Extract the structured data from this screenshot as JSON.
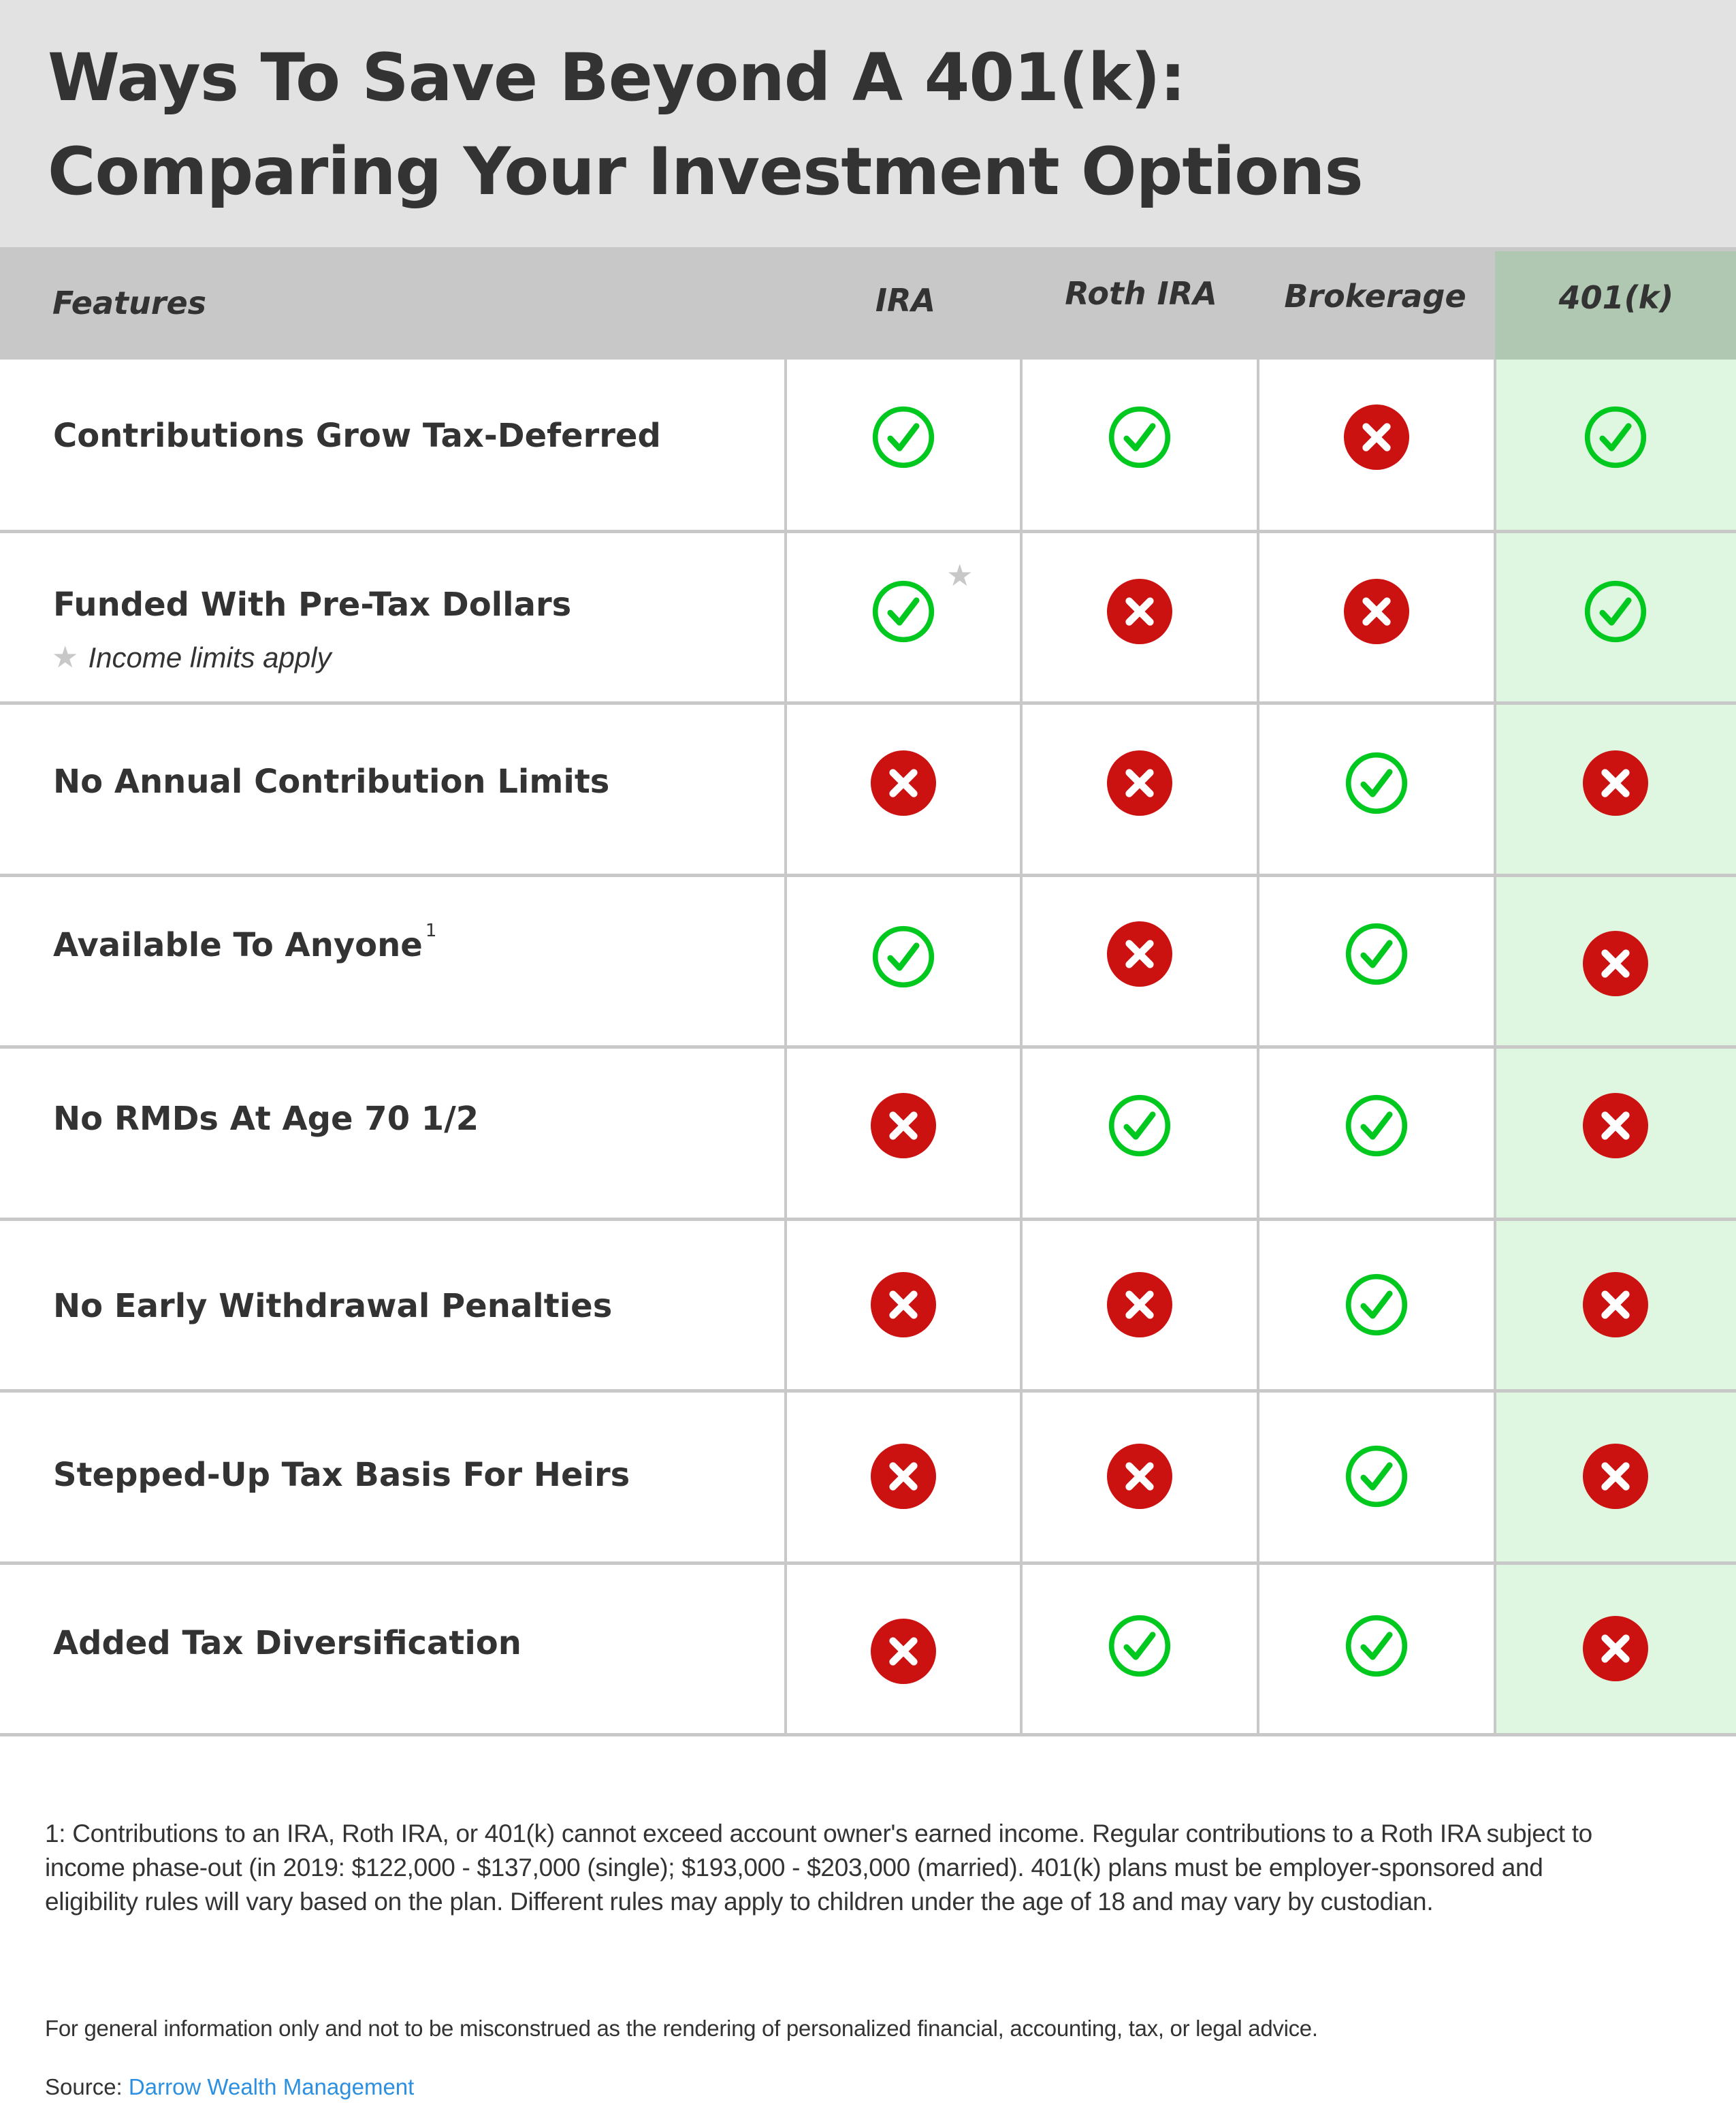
{
  "title": {
    "line1": "Ways To Save Beyond A 401(k):",
    "line2": "Comparing Your Investment Options"
  },
  "columns": {
    "features": "Features",
    "ira": "IRA",
    "roth_ira": "Roth IRA",
    "brokerage": "Brokerage",
    "k401": "401(k)"
  },
  "rows": [
    {
      "feature": "Contributions Grow Tax-Deferred",
      "ira": "check",
      "roth_ira": "check",
      "brokerage": "x",
      "k401": "check"
    },
    {
      "feature": "Funded With Pre-Tax Dollars",
      "note": "Income limits apply",
      "ira": "check",
      "ira_starred": true,
      "roth_ira": "x",
      "brokerage": "x",
      "k401": "check"
    },
    {
      "feature": "No Annual Contribution Limits",
      "ira": "x",
      "roth_ira": "x",
      "brokerage": "check",
      "k401": "x"
    },
    {
      "feature": "Available To Anyone",
      "footnote_ref": "1",
      "ira": "check",
      "roth_ira": "x",
      "brokerage": "check",
      "k401": "x"
    },
    {
      "feature": "No RMDs At Age 70 1/2",
      "ira": "x",
      "roth_ira": "check",
      "brokerage": "check",
      "k401": "x"
    },
    {
      "feature": "No Early Withdrawal Penalties",
      "ira": "x",
      "roth_ira": "x",
      "brokerage": "check",
      "k401": "x"
    },
    {
      "feature": "Stepped-Up Tax Basis For Heirs",
      "ira": "x",
      "roth_ira": "x",
      "brokerage": "check",
      "k401": "x"
    },
    {
      "feature": "Added Tax Diversification",
      "ira": "x",
      "roth_ira": "check",
      "brokerage": "check",
      "k401": "x"
    }
  ],
  "icons": {
    "check": "check-circle-icon",
    "x": "x-circle-icon",
    "star": "star-icon"
  },
  "colors": {
    "check": "#00C81E",
    "x": "#CC1111",
    "highlight_column": "#DFF7E0",
    "highlight_header": "#B0C8B2",
    "link": "#2D8FE0"
  },
  "star_glyph": "★",
  "footnote": "1: Contributions to an IRA, Roth IRA, or 401(k) cannot exceed account owner's earned income. Regular contributions to a Roth IRA subject to income phase-out (in 2019: $122,000 - $137,000 (single); $193,000 - $203,000 (married). 401(k) plans must be employer-sponsored and eligibility rules will vary based on the plan. Different rules may apply to children under the age of 18 and may vary by custodian.",
  "disclaimer": "For general information only and not to be misconstrued as the rendering of personalized financial, accounting, tax, or legal advice.",
  "source": {
    "label": "Source:",
    "link_text": "Darrow Wealth Management"
  }
}
